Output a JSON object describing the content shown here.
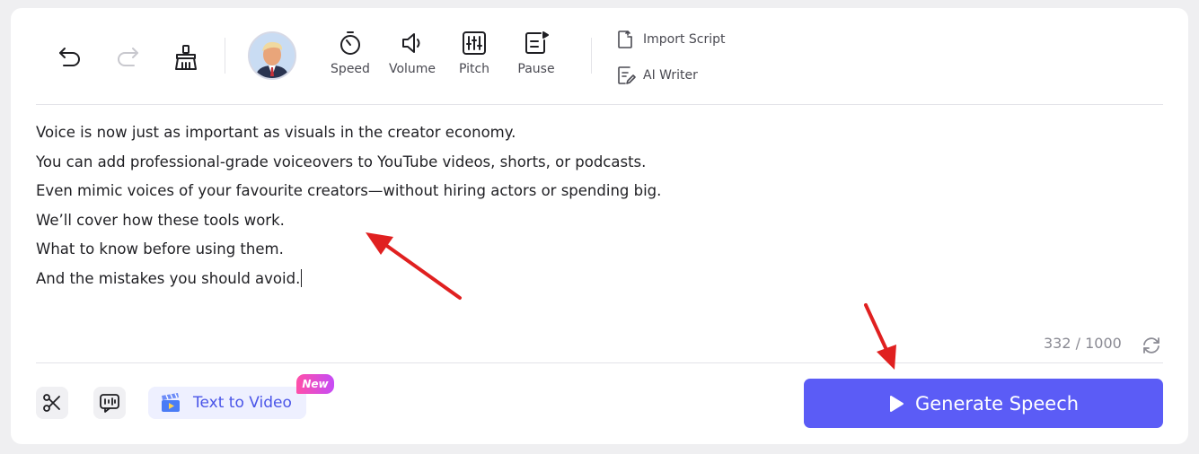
{
  "toolbar": {
    "undo_icon": "undo-icon",
    "redo_icon": "redo-icon",
    "clear_icon": "broom-icon",
    "tools": [
      {
        "label": "Speed",
        "icon": "stopwatch-icon"
      },
      {
        "label": "Volume",
        "icon": "speaker-icon"
      },
      {
        "label": "Pitch",
        "icon": "equalizer-icon"
      },
      {
        "label": "Pause",
        "icon": "pause-insert-icon"
      }
    ],
    "import_script": "Import Script",
    "ai_writer": "AI Writer"
  },
  "editor": {
    "lines": [
      "Voice is now just as important as visuals in the creator economy.",
      "You can add professional-grade voiceovers to YouTube videos, shorts, or podcasts.",
      "Even mimic voices of your favourite creators—without hiring actors or spending big.",
      "We’ll cover how these tools work.",
      "What to know before using them.",
      "And the mistakes you should avoid."
    ],
    "char_count": "332 / 1000"
  },
  "bottom": {
    "text_to_video": "Text to Video",
    "new_badge": "New",
    "generate_speech": "Generate Speech"
  },
  "colors": {
    "accent": "#5b5cf6",
    "annotation_arrow": "#e02020",
    "badge_gradient_start": "#ff4fa8",
    "badge_gradient_end": "#c64cf6"
  }
}
